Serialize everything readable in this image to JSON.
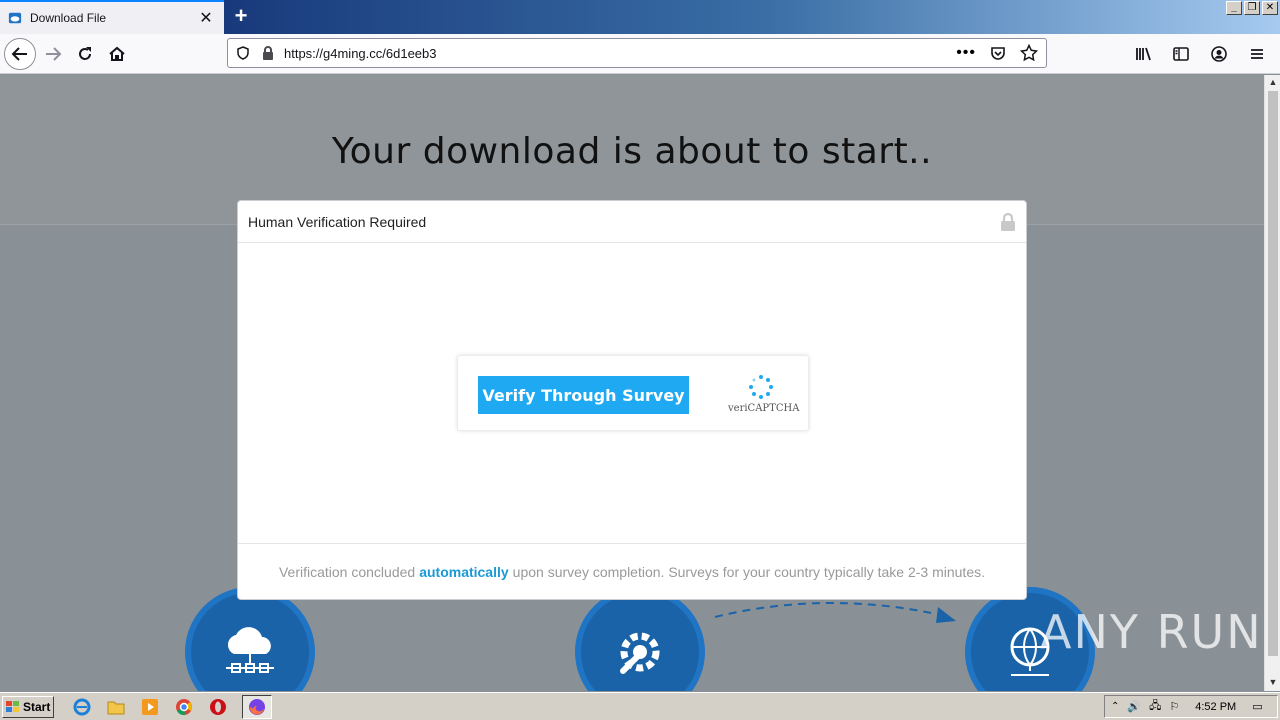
{
  "browser": {
    "tab_title": "Download File",
    "tab_close": "✕",
    "new_tab": "+",
    "url": "https://g4ming.cc/6d1eeb3",
    "window_controls": [
      "_",
      "❐",
      "✕"
    ]
  },
  "page": {
    "hero_title": "Your download is about to start..",
    "watermark": "ANY RUN"
  },
  "modal": {
    "title": "Human Verification Required",
    "verify_button": "Verify Through Survey",
    "captcha_brand": "veriCAPTCHA",
    "footer_before": "Verification concluded",
    "footer_emphasis": "automatically",
    "footer_after": "upon survey completion. Surveys for your country typically take 2-3 minutes.",
    "accent_color": "#1ea9f2"
  },
  "taskbar": {
    "start_label": "Start",
    "clock": "4:52 PM"
  }
}
